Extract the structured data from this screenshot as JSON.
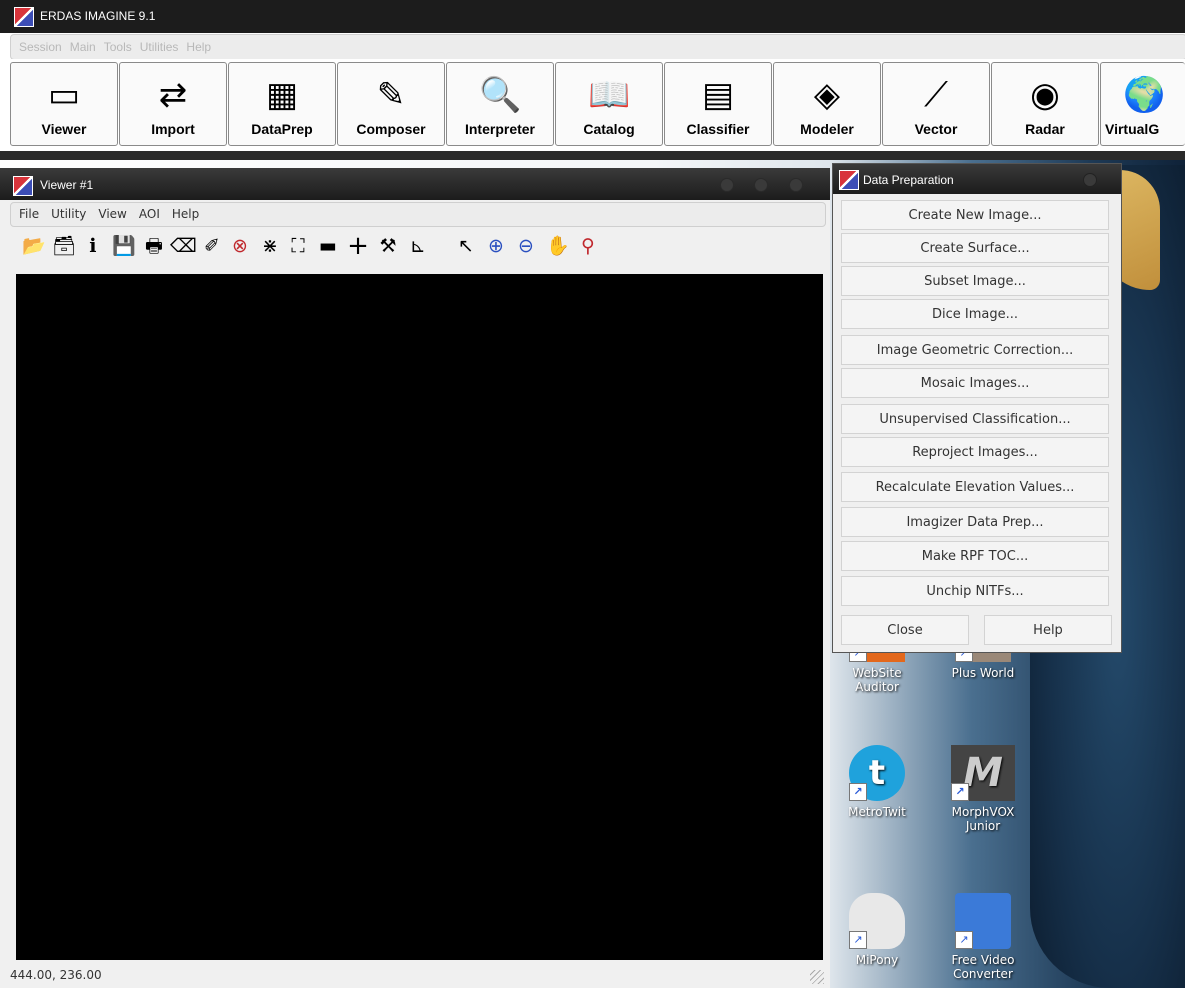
{
  "app": {
    "title": "ERDAS IMAGINE 9.1",
    "menu": [
      "Session",
      "Main",
      "Tools",
      "Utilities",
      "Help"
    ],
    "toolbar": [
      {
        "label": "Viewer",
        "icon": "viewer-icon",
        "glyph": "▭"
      },
      {
        "label": "Import",
        "icon": "import-icon",
        "glyph": "⇄"
      },
      {
        "label": "DataPrep",
        "icon": "dataprep-icon",
        "glyph": "▦"
      },
      {
        "label": "Composer",
        "icon": "composer-icon",
        "glyph": "✎"
      },
      {
        "label": "Interpreter",
        "icon": "interpreter-icon",
        "glyph": "🔍"
      },
      {
        "label": "Catalog",
        "icon": "catalog-icon",
        "glyph": "📖"
      },
      {
        "label": "Classifier",
        "icon": "classifier-icon",
        "glyph": "▤"
      },
      {
        "label": "Modeler",
        "icon": "modeler-icon",
        "glyph": "◈"
      },
      {
        "label": "Vector",
        "icon": "vector-icon",
        "glyph": "⟋"
      },
      {
        "label": "Radar",
        "icon": "radar-icon",
        "glyph": "◉"
      },
      {
        "label": "VirtualG",
        "icon": "globe-icon",
        "glyph": "🌍"
      }
    ]
  },
  "viewer": {
    "title": "Viewer #1",
    "menu": [
      "File",
      "Utility",
      "View",
      "AOI",
      "Help"
    ],
    "tools": [
      {
        "name": "open-icon",
        "glyph": "📂"
      },
      {
        "name": "open-layer-icon",
        "glyph": "🗃"
      },
      {
        "name": "info-icon",
        "glyph": "ℹ"
      },
      {
        "name": "save-icon",
        "glyph": "💾"
      },
      {
        "name": "print-icon",
        "glyph": "🖶"
      },
      {
        "name": "eraser-icon",
        "glyph": "⌫"
      },
      {
        "name": "pencil-icon",
        "glyph": "✐"
      },
      {
        "name": "clear-icon",
        "glyph": "⊗"
      },
      {
        "name": "zoom-in-fit-icon",
        "glyph": "⋇"
      },
      {
        "name": "zoom-out-fit-icon",
        "glyph": "⛶"
      },
      {
        "name": "ruler-icon",
        "glyph": "▬"
      },
      {
        "name": "crosshair-icon",
        "glyph": "+"
      },
      {
        "name": "hammer-icon",
        "glyph": "⚒"
      },
      {
        "name": "profile-icon",
        "glyph": "⊾"
      },
      {
        "name": "pointer-icon",
        "glyph": "↖"
      },
      {
        "name": "zoom-in-icon",
        "glyph": "⊕"
      },
      {
        "name": "zoom-out-icon",
        "glyph": "⊖"
      },
      {
        "name": "pan-hand-icon",
        "glyph": "✋"
      },
      {
        "name": "inquire-icon",
        "glyph": "⚲"
      }
    ],
    "status": "444.00, 236.00"
  },
  "data_prep": {
    "title": "Data Preparation",
    "items": [
      "Create New Image...",
      "Create Surface...",
      "Subset Image...",
      "Dice Image...",
      "Image Geometric Correction...",
      "Mosaic Images...",
      "Unsupervised Classification...",
      "Reproject Images...",
      "Recalculate Elevation Values...",
      "Imagizer Data Prep...",
      "Make RPF TOC...",
      "Unchip NITFs..."
    ],
    "close_label": "Close",
    "help_label": "Help"
  },
  "desktop": {
    "icons": [
      {
        "label_1": "WebSite",
        "label_2": "Auditor",
        "icon": "website-auditor-icon",
        "color": "#e3681c"
      },
      {
        "label_1": "Plus World",
        "label_2": "",
        "icon": "plus-world-icon",
        "color": "#9a8878"
      },
      {
        "label_1": "MetroTwit",
        "label_2": "",
        "icon": "metrotwit-icon",
        "color": "#1fa2dc"
      },
      {
        "label_1": "MorphVOX",
        "label_2": "Junior",
        "icon": "morphvox-icon",
        "color": "#444444"
      },
      {
        "label_1": "MiPony",
        "label_2": "",
        "icon": "mipony-icon",
        "color": "#e8e8e8"
      },
      {
        "label_1": "Free Video",
        "label_2": "Converter",
        "icon": "free-video-converter-icon",
        "color": "#3b7ad8"
      }
    ]
  }
}
